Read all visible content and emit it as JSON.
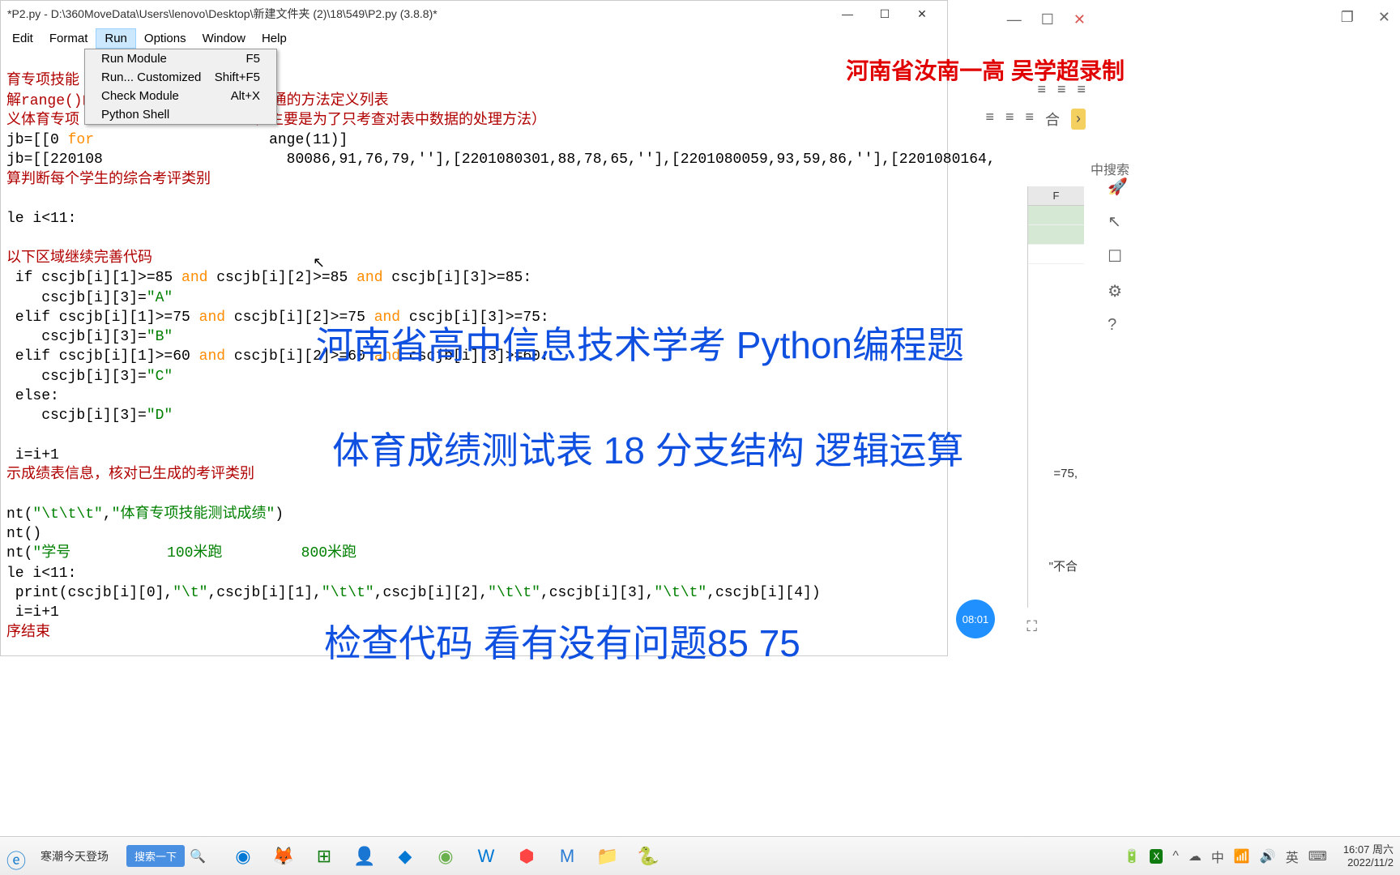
{
  "window": {
    "title": "*P2.py - D:\\360MoveData\\Users\\lenovo\\Desktop\\新建文件夹 (2)\\18\\549\\P2.py (3.8.8)*"
  },
  "menubar": {
    "edit": "Edit",
    "format": "Format",
    "run": "Run",
    "options": "Options",
    "window": "Window",
    "help": "Help"
  },
  "run_menu": {
    "run_module": "Run Module",
    "run_module_key": "F5",
    "run_custom": "Run... Customized",
    "run_custom_key": "Shift+F5",
    "check_module": "Check Module",
    "check_module_key": "Alt+X",
    "python_shell": "Python Shell"
  },
  "code": {
    "c1": "育专项技能",
    "c2": "解range()函",
    "c2b": "通的方法定义列表",
    "c3": "义体育专项",
    "c3b": "值主要是为了只考查对表中数据的处理方法）",
    "l4a": "jb=[[0 ",
    "l4b": "for",
    "l4c": "                    ange(11)]",
    "l5": "jb=[[220108                     80086,91,76,79,''],[2201080301,88,78,65,''],[2201080059,93,59,86,''],[2201080164,",
    "c6": "算判断每个学生的综合考评类别",
    "l8": "le i<11:",
    "c9": "以下区域继续完善代码",
    "l10": " if cscjb[i][1]>=85 ",
    "l10b": " cscjb[i][2]>=85 ",
    "l10c": " cscjb[i][3]>=85:",
    "l11a": "    cscjb[i][3]=",
    "l11b": "\"A\"",
    "l12": " elif cscjb[i][1]>=75 ",
    "l12b": " cscjb[i][2]>=75 ",
    "l12c": " cscjb[i][3]>=75:",
    "l13b": "\"B\"",
    "l14": " elif cscjb[i][1]>=60 ",
    "l14b": " cscjb[i][2]>=60 ",
    "l14c": " cscjb[i][3]>=60:",
    "l15b": "\"C\"",
    "l16": " else:",
    "l17b": "\"D\"",
    "l19": " i=i+1",
    "c20": "示成绩表信息，核对已生成的考评类别",
    "l22a": "nt(",
    "l22b": "\"\\t\\t\\t\"",
    "l22c": ",",
    "l22d": "\"体育专项技能测试成绩\"",
    "l22e": ")",
    "l23": "nt()",
    "l24a": "nt(",
    "l24b": "\"学号           100米跑         800米跑",
    "l25": "le i<11:",
    "l26a": " print(cscjb[i][0],",
    "l26b": "\"\\t\"",
    "l26c": ",cscjb[i][1],",
    "l26d": "\"\\t\\t\"",
    "l26e": ",cscjb[i][2],",
    "l26f": "\"\\t\\t\"",
    "l26g": ",cscjb[i][3],",
    "l26h": "\"\\t\\t\"",
    "l26i": ",cscjb[i][4])",
    "l27": " i=i+1",
    "c28": "序结束",
    "kw_and": "and",
    "kw_for": "for"
  },
  "overlays": {
    "red": "河南省汝南一高 吴学超录制",
    "blue1": "河南省高中信息技术学考 Python编程题",
    "blue2": "体育成绩测试表 18  分支结构 逻辑运算",
    "blue3": "检查代码 看有没有问题85 75"
  },
  "excel": {
    "col": "F",
    "search": "中搜索",
    "frag1": "=75,",
    "frag2": "\"不合",
    "timer": "08:01"
  },
  "taskbar": {
    "weather": "寒潮今天登场",
    "search_btn": "搜索一下"
  },
  "tray": {
    "ime1": "中",
    "ime2": "英",
    "time": "16:07",
    "day": "周六",
    "date": "2022/11/2"
  }
}
